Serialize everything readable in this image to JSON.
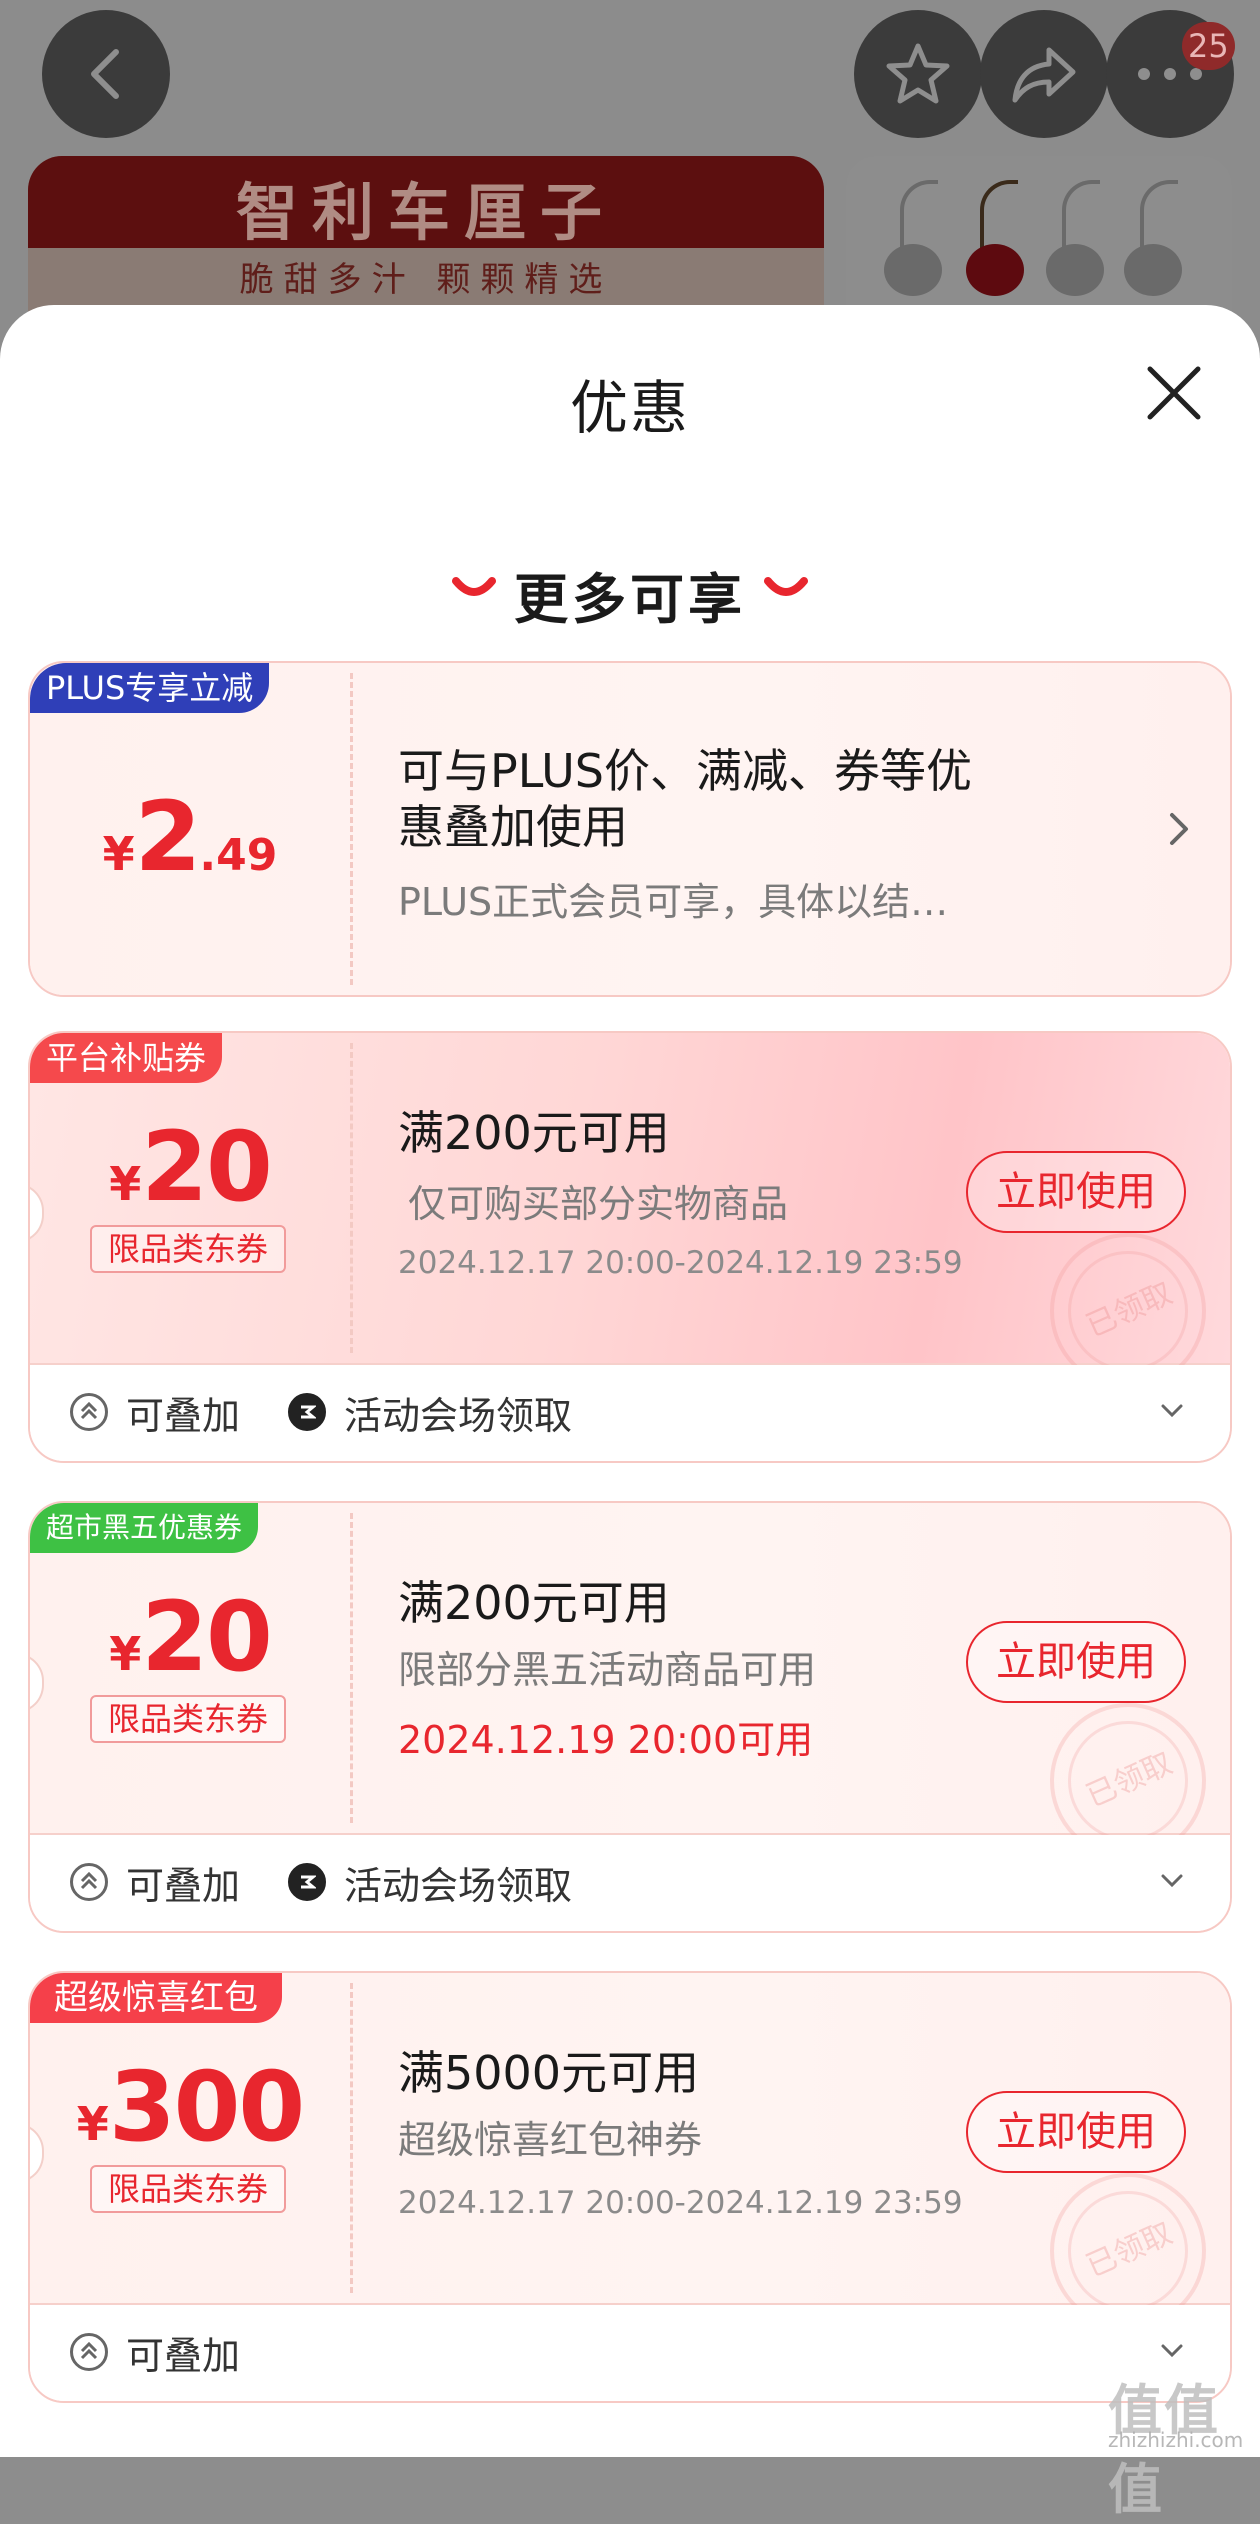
{
  "nav": {
    "badge_count": "25",
    "icons": [
      "back-icon",
      "star-icon",
      "share-icon",
      "more-icon"
    ]
  },
  "banner": {
    "title": "智利车厘子",
    "subtitle": "脆甜多汁 颗颗精选"
  },
  "sheet": {
    "title": "优惠",
    "section_heading": "更多可享"
  },
  "plus_coupon": {
    "tag": "PLUS专享立减",
    "currency": "¥",
    "amount_int": "2",
    "amount_dec": ".49",
    "title_line1": "可与PLUS价、满减、券等优",
    "title_line2": "惠叠加使用",
    "desc": "PLUS正式会员可享，具体以结…"
  },
  "coupons": [
    {
      "tag": "平台补贴券",
      "currency": "¥",
      "amount": "20",
      "limit": "限品类东券",
      "title": "满200元可用",
      "desc": "仅可购买部分实物商品",
      "date": "2024.12.17 20:00-2024.12.19 23:59",
      "button": "立即使用",
      "stamp": "已领取",
      "foot_stack": "可叠加",
      "foot_source": "活动会场领取"
    },
    {
      "tag": "超市黑五优惠券",
      "currency": "¥",
      "amount": "20",
      "limit": "限品类东券",
      "title": "满200元可用",
      "desc": "限部分黑五活动商品可用",
      "date": "2024.12.19 20:00可用",
      "button": "立即使用",
      "stamp": "已领取",
      "foot_stack": "可叠加",
      "foot_source": "活动会场领取"
    },
    {
      "tag": "超级惊喜红包",
      "currency": "¥",
      "amount": "300",
      "limit": "限品类东券",
      "title": "满5000元可用",
      "desc": "超级惊喜红包神券",
      "date": "2024.12.17 20:00-2024.12.19 23:59",
      "button": "立即使用",
      "stamp": "已领取",
      "foot_stack": "可叠加"
    }
  ],
  "watermark": {
    "main": "值值值",
    "sub": "zhizhizhi.com"
  },
  "colors": {
    "accent_red": "#e8262e",
    "plus_blue": "#2f3fb8",
    "green_tag": "#3ec144"
  }
}
